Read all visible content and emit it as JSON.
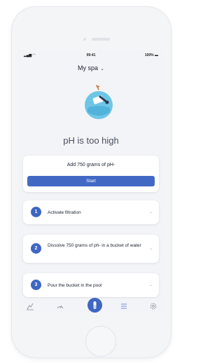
{
  "statusbar": {
    "time": "09:41",
    "battery": "100%"
  },
  "header": {
    "title": "My spa"
  },
  "status": {
    "message": "pH is too high"
  },
  "dose": {
    "text": "Add 750 grams of pH-",
    "button_label": "Start"
  },
  "steps": [
    {
      "number": "1",
      "text": "Activate filtration"
    },
    {
      "number": "2",
      "text": "Dissolve 750 grams of ph- in a bucket of water"
    },
    {
      "number": "3",
      "text": "Pour the bucket in the pool"
    }
  ],
  "colors": {
    "accent": "#3e66c2",
    "illustration": "#6ec6e6"
  },
  "tabbar": {
    "items": [
      "chart-icon",
      "gauge-icon",
      "treatment-icon",
      "list-icon",
      "settings-icon"
    ],
    "active_index": 2
  }
}
